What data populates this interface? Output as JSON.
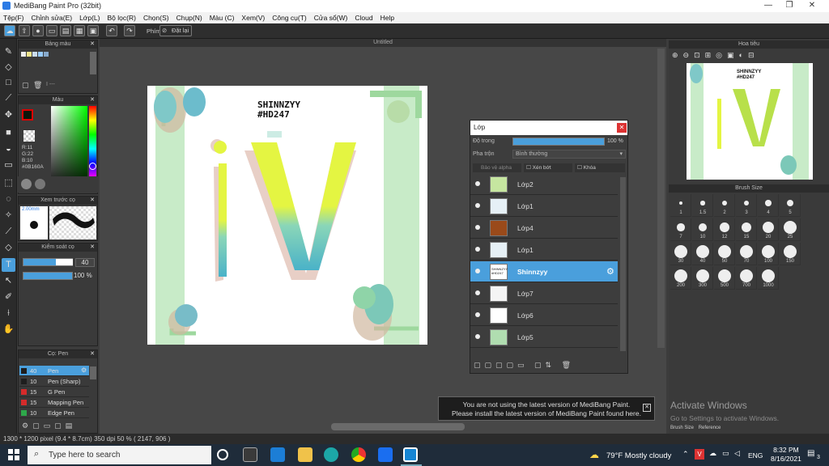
{
  "window": {
    "title": "MediBang Paint Pro (32bit)"
  },
  "menu": [
    "Tệp(F)",
    "Chỉnh sửa(E)",
    "Lớp(L)",
    "Bộ lọc(R)",
    "Chọn(S)",
    "Chụp(N)",
    "Màu (C)",
    "Xem(V)",
    "Công cụ(T)",
    "Cửa sổ(W)",
    "Cloud",
    "Help"
  ],
  "toolbar": {
    "phim_label": "Phím",
    "reset_label": "Đặt lại"
  },
  "canvas": {
    "tab_title": "Untitled",
    "art_title": "SHINNZYY",
    "art_tag": "#HD247"
  },
  "color_swatch_panel": {
    "title": "Bảng màu",
    "placeholder": "I ---"
  },
  "color_panel": {
    "title": "Màu",
    "r": "R:11",
    "g": "G:22",
    "b": "B:10",
    "hex": "#0B160A",
    "fg": "#0b160a"
  },
  "brush_preview": {
    "title": "Xem trước cọ",
    "size": "2.00mm"
  },
  "brush_control": {
    "title": "Kiểm soát cọ",
    "size_value": "40",
    "opacity_value": "100 %"
  },
  "brush_list": {
    "title": "Cọ: Pen",
    "items": [
      {
        "size": "40",
        "name": "Pen",
        "color": "#1e1e1e",
        "selected": true
      },
      {
        "size": "10",
        "name": "Pen (Sharp)",
        "color": "#1e1e1e",
        "selected": false
      },
      {
        "size": "15",
        "name": "G Pen",
        "color": "#d52b2b",
        "selected": false
      },
      {
        "size": "15",
        "name": "Mapping Pen",
        "color": "#d52b2b",
        "selected": false
      },
      {
        "size": "10",
        "name": "Edge Pen",
        "color": "#2ea84a",
        "selected": false
      }
    ]
  },
  "layer_panel": {
    "title": "Lớp",
    "opacity_label": "Độ trong",
    "opacity_value": "100 %",
    "blend_label": "Pha trộn",
    "blend_value": "Bình thường",
    "chk_alpha": "Bảo vệ alpha",
    "chk_clip": "Xén bớt",
    "chk_lock": "Khóa",
    "layers": [
      {
        "name": "Lớp2",
        "selected": false,
        "thumb": "#c6e6a0"
      },
      {
        "name": "Lớp1",
        "selected": false,
        "thumb": "#e6f0f6"
      },
      {
        "name": "Lớp4",
        "selected": false,
        "thumb": "#9a4a1a"
      },
      {
        "name": "Lớp1",
        "selected": false,
        "thumb": "#e6f0f6"
      },
      {
        "name": "Shinnzyy",
        "selected": true,
        "thumb": "#ffffff",
        "thumb_text": "SHINNZYY #HD247"
      },
      {
        "name": "Lớp7",
        "selected": false,
        "thumb": "#f4f4f4"
      },
      {
        "name": "Lớp6",
        "selected": false,
        "thumb": "#ffffff"
      },
      {
        "name": "Lớp5",
        "selected": false,
        "thumb": "#b0ddb0"
      }
    ]
  },
  "navigator": {
    "title": "Hoa tiêu",
    "art_title": "SHINNZYY",
    "art_tag": "#HD247"
  },
  "brush_size": {
    "title": "Brush Size",
    "sizes": [
      "1",
      "1.5",
      "2",
      "3",
      "4",
      "5",
      "7",
      "10",
      "12",
      "15",
      "20",
      "25",
      "30",
      "40",
      "50",
      "70",
      "100",
      "150",
      "200",
      "300",
      "500",
      "700",
      "1000"
    ],
    "tabs": [
      "Brush Size",
      "Reference"
    ]
  },
  "activation": {
    "line1": "Activate Windows",
    "line2": "Go to Settings to activate Windows."
  },
  "status": {
    "text": "1300 * 1200 pixel   (9.4 * 8.7cm)   350 dpi   50 %   ( 2147, 906 )"
  },
  "toast": {
    "line1": "You are not using the latest version of MediBang Paint.",
    "line2": "Please install the latest version of MediBang Paint found here."
  },
  "taskbar": {
    "search_placeholder": "Type here to search",
    "weather": "79°F  Mostly cloudy",
    "lang": "ENG",
    "time": "8:32 PM",
    "date": "8/16/2021",
    "notif_count": "3"
  }
}
